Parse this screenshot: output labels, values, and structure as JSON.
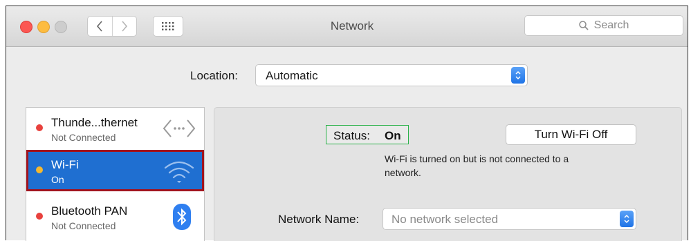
{
  "window": {
    "title": "Network"
  },
  "toolbar": {
    "back_icon": "chevron-left-icon",
    "forward_icon": "chevron-right-icon",
    "grid_icon": "grid-icon",
    "search_placeholder": "Search"
  },
  "location": {
    "label": "Location:",
    "value": "Automatic"
  },
  "services": [
    {
      "name": "Thunde...thernet",
      "status": "Not Connected",
      "dot_color": "#e8413d",
      "icon": "ethernet-arrows-icon"
    },
    {
      "name": "Wi-Fi",
      "status": "On",
      "dot_color": "#f5b82e",
      "icon": "wifi-icon",
      "selected": true
    },
    {
      "name": "Bluetooth PAN",
      "status": "Not Connected",
      "dot_color": "#e8413d",
      "icon": "bluetooth-icon"
    }
  ],
  "detail": {
    "status_label": "Status:",
    "status_value": "On",
    "turn_off_label": "Turn Wi-Fi Off",
    "status_line1": "Wi-Fi is turned on but is not connected to a",
    "status_line2": "network.",
    "network_name_label": "Network Name:",
    "network_name_placeholder": "No network selected"
  },
  "colors": {
    "selection": "#1f6fd1",
    "highlight_border": "#a2141e",
    "status_border": "#2bb14a"
  }
}
